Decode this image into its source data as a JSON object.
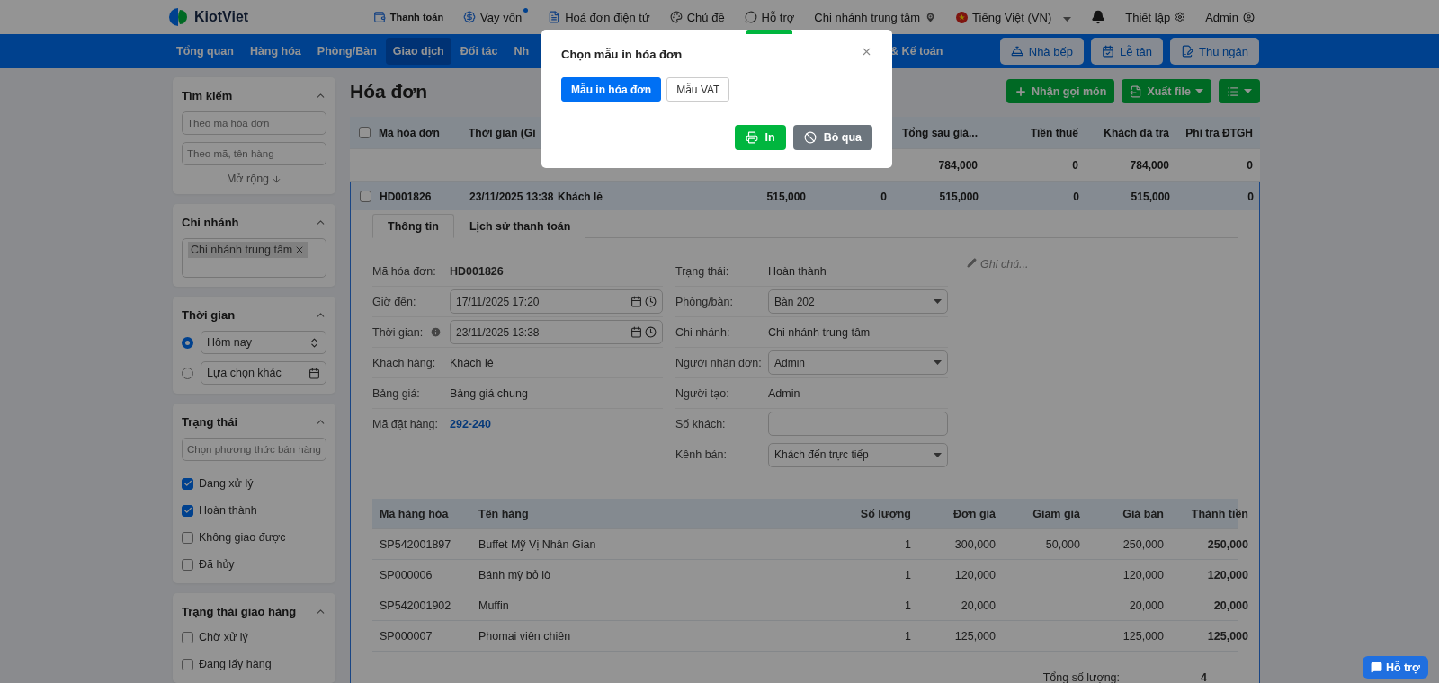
{
  "topbar": {
    "logo": "KiotViet",
    "links": [
      {
        "kind": "payment",
        "label": "Thanh toán",
        "dot": false,
        "highlighted": false
      },
      {
        "kind": "loan",
        "label": "Vay vốn",
        "dot": true,
        "highlighted": false
      },
      {
        "kind": "einvoice",
        "label": "Hoá đơn điện tử",
        "dot": false,
        "highlighted": false
      },
      {
        "kind": "theme",
        "label": "Chủ đề",
        "dot": false,
        "highlighted": false
      },
      {
        "kind": "support",
        "label": "Hỗ trợ",
        "dot": false,
        "highlighted": true
      }
    ],
    "branch": "Chi nhánh trung tâm",
    "language": "Tiếng Việt (VN)",
    "settings": "Thiết lập",
    "user": "Admin"
  },
  "nav": {
    "items": [
      {
        "label": "Tổng quan",
        "selected": false
      },
      {
        "label": "Hàng hóa",
        "selected": false
      },
      {
        "label": "Phòng/Bàn",
        "selected": false
      },
      {
        "label": "Giao dịch",
        "selected": true
      },
      {
        "label": "Đối tác",
        "selected": false
      },
      {
        "label": "Nh",
        "selected": false
      },
      {
        "label": "& Kế toán",
        "selected": false
      }
    ],
    "buttons": [
      {
        "kind": "kitchen",
        "label": "Nhà bếp"
      },
      {
        "kind": "reception",
        "label": "Lễ tân"
      },
      {
        "kind": "cashier",
        "label": "Thu ngân"
      }
    ]
  },
  "sidebar": [
    {
      "title": "Tìm kiếm",
      "expanded": true,
      "items": [
        {
          "kind": "input",
          "placeholder": "Theo mã hóa đơn"
        },
        {
          "kind": "input",
          "placeholder": "Theo mã, tên hàng"
        },
        {
          "kind": "link",
          "label": "Mở rộng"
        }
      ]
    },
    {
      "title": "Chi nhánh",
      "expanded": true,
      "items": [
        {
          "kind": "tags",
          "tags": [
            "Chi nhánh trung tâm"
          ]
        }
      ]
    },
    {
      "title": "Thời gian",
      "expanded": true,
      "items": [
        {
          "kind": "radio-select",
          "selected": true,
          "value": "Hôm nay"
        },
        {
          "kind": "radio-date",
          "selected": false,
          "value": "Lựa chọn khác"
        }
      ]
    },
    {
      "title": "Trạng thái",
      "expanded": true,
      "items": [
        {
          "kind": "input",
          "placeholder": "Chọn phương thức bán hàng"
        },
        {
          "kind": "checkbox",
          "label": "Đang xử lý",
          "checked": true
        },
        {
          "kind": "checkbox",
          "label": "Hoàn thành",
          "checked": true
        },
        {
          "kind": "checkbox",
          "label": "Không giao được",
          "checked": false
        },
        {
          "kind": "checkbox",
          "label": "Đã hủy",
          "checked": false
        }
      ]
    },
    {
      "title": "Trạng thái giao hàng",
      "expanded": true,
      "items": [
        {
          "kind": "checkbox",
          "label": "Chờ xử lý",
          "checked": false
        },
        {
          "kind": "checkbox",
          "label": "Đang lấy hàng",
          "checked": false
        }
      ]
    }
  ],
  "page": {
    "title": "Hóa đơn",
    "actions": [
      {
        "kind": "add",
        "label": "Nhận gọi món"
      },
      {
        "kind": "export",
        "label": "Xuất file"
      },
      {
        "kind": "layout"
      }
    ]
  },
  "invoices": {
    "all_checked": false,
    "columns_left": [
      "Mã hóa đơn",
      "Thời gian (Gi"
    ],
    "columns_right": [
      "Tổng sau giá...",
      "Tiền thuế",
      "Khách đã trả",
      "Phí trả ĐTGH"
    ],
    "summary": [
      "784,000",
      "0",
      "784,000",
      "0"
    ],
    "rows": [
      {
        "checked": false,
        "expanded": true,
        "cells": [
          "HD001826",
          "23/11/2025 13:38",
          "Khách lẻ",
          "515,000",
          "0",
          "515,000",
          "0",
          "515,000",
          "0"
        ]
      }
    ]
  },
  "detail": {
    "tabs": [
      {
        "label": "Thông tin",
        "selected": true
      },
      {
        "label": "Lịch sử thanh toán",
        "selected": false
      }
    ],
    "left": [
      {
        "kind": "bold",
        "label": "Mã hóa đơn:",
        "value": "HD001826",
        "info": false
      },
      {
        "kind": "datetime",
        "label": "Giờ đến:",
        "value": "17/11/2025 17:20",
        "info": false
      },
      {
        "kind": "datetime",
        "label": "Thời gian:",
        "value": "23/11/2025 13:38",
        "info": true
      },
      {
        "kind": "text",
        "label": "Khách hàng:",
        "value": "Khách lẻ",
        "info": false
      },
      {
        "kind": "text",
        "label": "Bảng giá:",
        "value": "Bảng giá chung",
        "info": false
      },
      {
        "kind": "link",
        "label": "Mã đặt hàng:",
        "value": "292-240",
        "info": false
      }
    ],
    "right": [
      {
        "kind": "text",
        "label": "Trạng thái:",
        "value": "Hoàn thành",
        "info": false
      },
      {
        "kind": "select",
        "label": "Phòng/bàn:",
        "value": "Bàn 202",
        "info": false
      },
      {
        "kind": "text",
        "label": "Chi nhánh:",
        "value": "Chi nhánh trung tâm",
        "info": false
      },
      {
        "kind": "select",
        "label": "Người nhận đơn:",
        "value": "Admin",
        "info": false
      },
      {
        "kind": "text",
        "label": "Người tạo:",
        "value": "Admin",
        "info": false
      },
      {
        "kind": "input",
        "label": "Số khách:",
        "info": false
      },
      {
        "kind": "select",
        "label": "Kênh bán:",
        "value": "Khách đến trực tiếp",
        "info": false
      }
    ],
    "note": {
      "placeholder": "Ghi chú..."
    },
    "products": {
      "columns": [
        "Mã hàng hóa",
        "Tên hàng",
        "Số lượng",
        "Đơn giá",
        "Giảm giá",
        "Giá bán",
        "Thành tiền"
      ],
      "rows": [
        {
          "code": "SP542001897",
          "name": "Buffet Mỹ Vị Nhân Gian",
          "qty": "1",
          "price": "300,000",
          "discount": "50,000",
          "sale": "250,000",
          "total": "250,000"
        },
        {
          "code": "SP000006",
          "name": "Bánh mỳ bỏ lò",
          "qty": "1",
          "price": "120,000",
          "sale": "120,000",
          "total": "120,000"
        },
        {
          "code": "SP542001902",
          "name": "Muffin",
          "qty": "1",
          "price": "20,000",
          "sale": "20,000",
          "total": "20,000"
        },
        {
          "code": "SP000007",
          "name": "Phomai viên chiên",
          "qty": "1",
          "price": "125,000",
          "sale": "125,000",
          "total": "125,000"
        }
      ]
    },
    "totals": [
      {
        "label": "Tổng số lượng:",
        "value": "4"
      }
    ]
  },
  "dialog": {
    "title": "Chọn mẫu in hóa đơn",
    "templates": [
      {
        "label": "Mẫu in hóa đơn",
        "selected": true
      },
      {
        "label": "Mẫu VAT",
        "selected": false
      }
    ],
    "buttons": [
      {
        "kind": "print",
        "label": "In"
      },
      {
        "kind": "cancel",
        "label": "Bỏ qua"
      }
    ]
  },
  "help": {
    "label": "Hỗ trợ"
  }
}
